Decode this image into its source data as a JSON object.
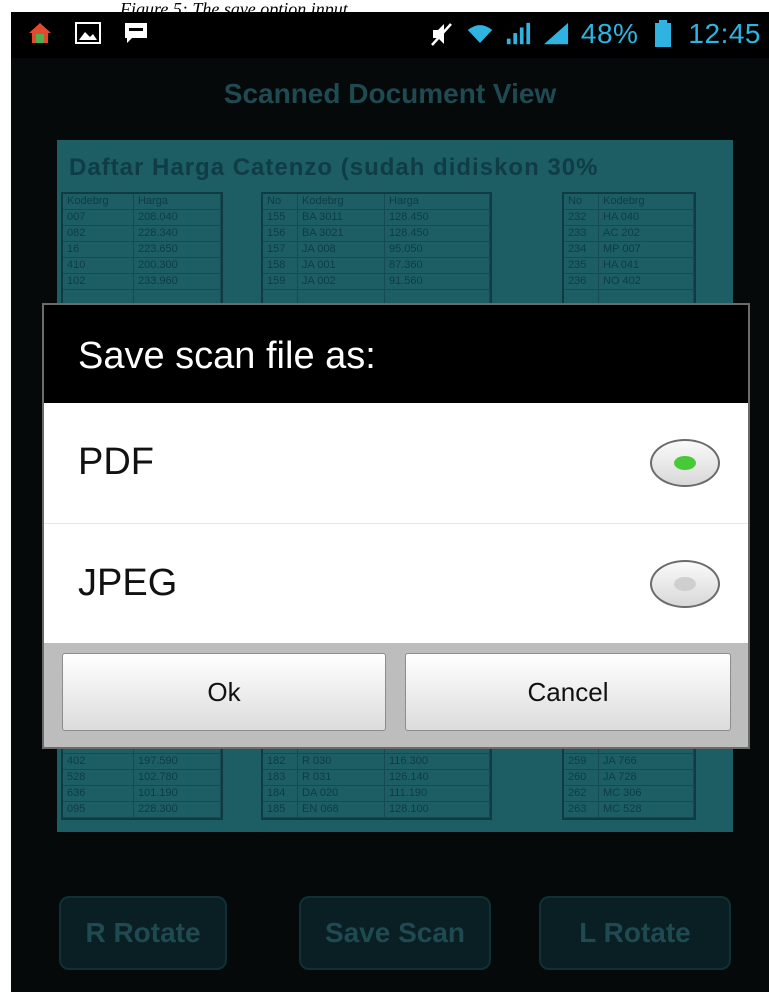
{
  "caption": "Figure 5: The save option input.",
  "status_bar": {
    "battery_percent": "48%",
    "time": "12:45",
    "accent_color": "#2fb4e2",
    "left_icons": [
      "maps-icon",
      "image-icon",
      "chat-icon"
    ],
    "right_icons": [
      "mute-icon",
      "wifi-icon",
      "signal-icon",
      "signal-icon-2",
      "battery-icon"
    ]
  },
  "screen": {
    "title": "Scanned Document View"
  },
  "scan": {
    "heading": "Daftar Harga Catenzo (sudah didiskon 30%",
    "tables": [
      {
        "headers": [
          "Kodebrg",
          "Harga"
        ],
        "rows": [
          [
            "007",
            "208.040"
          ],
          [
            "082",
            "228.340"
          ],
          [
            "16",
            "223.650"
          ],
          [
            "410",
            "200.300"
          ],
          [
            "102",
            "233.960"
          ],
          [
            "",
            ""
          ],
          [
            "",
            ""
          ],
          [
            "",
            ""
          ],
          [
            "",
            ""
          ],
          [
            "",
            ""
          ],
          [
            "",
            ""
          ],
          [
            "",
            ""
          ],
          [
            "",
            ""
          ],
          [
            "",
            ""
          ],
          [
            "",
            ""
          ],
          [
            "",
            ""
          ],
          [
            "",
            ""
          ],
          [
            "",
            ""
          ],
          [
            "",
            ""
          ],
          [
            "",
            ""
          ],
          [
            "",
            ""
          ],
          [
            "",
            ""
          ],
          [
            "",
            ""
          ],
          [
            "",
            ""
          ],
          [
            "",
            ""
          ],
          [
            "",
            ""
          ],
          [
            "",
            ""
          ],
          [
            "",
            ""
          ],
          [
            "",
            ""
          ],
          [
            "",
            ""
          ],
          [
            "",
            ""
          ],
          [
            "",
            ""
          ],
          [
            "",
            ""
          ],
          [
            "",
            ""
          ],
          [
            "402",
            "197.590"
          ],
          [
            "528",
            "102.780"
          ],
          [
            "636",
            "101.190"
          ],
          [
            "095",
            "228.300"
          ]
        ]
      },
      {
        "headers": [
          "No",
          "Kodebrg",
          "Harga"
        ],
        "rows": [
          [
            "155",
            "BA 3011",
            "128.450"
          ],
          [
            "156",
            "BA 3021",
            "128.450"
          ],
          [
            "157",
            "JA 008",
            "95.050"
          ],
          [
            "158",
            "JA 001",
            "87.360"
          ],
          [
            "159",
            "JA 002",
            "91.560"
          ],
          [
            "",
            "",
            ""
          ],
          [
            "",
            "",
            ""
          ],
          [
            "",
            "",
            ""
          ],
          [
            "",
            "",
            ""
          ],
          [
            "",
            "",
            ""
          ],
          [
            "",
            "",
            ""
          ],
          [
            "",
            "",
            ""
          ],
          [
            "",
            "",
            ""
          ],
          [
            "",
            "",
            ""
          ],
          [
            "",
            "",
            ""
          ],
          [
            "",
            "",
            ""
          ],
          [
            "",
            "",
            ""
          ],
          [
            "",
            "",
            ""
          ],
          [
            "",
            "",
            ""
          ],
          [
            "",
            "",
            ""
          ],
          [
            "",
            "",
            ""
          ],
          [
            "",
            "",
            ""
          ],
          [
            "",
            "",
            ""
          ],
          [
            "",
            "",
            ""
          ],
          [
            "",
            "",
            ""
          ],
          [
            "",
            "",
            ""
          ],
          [
            "",
            "",
            ""
          ],
          [
            "",
            "",
            ""
          ],
          [
            "",
            "",
            ""
          ],
          [
            "",
            "",
            ""
          ],
          [
            "",
            "",
            ""
          ],
          [
            "",
            "",
            ""
          ],
          [
            "",
            "",
            ""
          ],
          [
            "",
            "",
            ""
          ],
          [
            "182",
            "R 030",
            "116.300"
          ],
          [
            "183",
            "R 031",
            "126.140"
          ],
          [
            "184",
            "DA 020",
            "111.190"
          ],
          [
            "185",
            "EN 068",
            "128.100"
          ]
        ]
      },
      {
        "headers": [
          "No",
          "Kodebrg"
        ],
        "rows": [
          [
            "232",
            "HA 040"
          ],
          [
            "233",
            "AC 202"
          ],
          [
            "234",
            "MP 007"
          ],
          [
            "235",
            "HA 041"
          ],
          [
            "236",
            "NO 402"
          ],
          [
            "",
            ""
          ],
          [
            "",
            ""
          ],
          [
            "",
            ""
          ],
          [
            "",
            ""
          ],
          [
            "",
            ""
          ],
          [
            "",
            ""
          ],
          [
            "",
            ""
          ],
          [
            "",
            ""
          ],
          [
            "",
            ""
          ],
          [
            "",
            ""
          ],
          [
            "",
            ""
          ],
          [
            "",
            ""
          ],
          [
            "",
            ""
          ],
          [
            "",
            ""
          ],
          [
            "",
            ""
          ],
          [
            "",
            ""
          ],
          [
            "",
            ""
          ],
          [
            "",
            ""
          ],
          [
            "",
            ""
          ],
          [
            "",
            ""
          ],
          [
            "",
            ""
          ],
          [
            "",
            ""
          ],
          [
            "",
            ""
          ],
          [
            "",
            ""
          ],
          [
            "",
            ""
          ],
          [
            "",
            ""
          ],
          [
            "",
            ""
          ],
          [
            "",
            ""
          ],
          [
            "",
            ""
          ],
          [
            "259",
            "JA 766"
          ],
          [
            "260",
            "JA 728"
          ],
          [
            "262",
            "MC 306"
          ],
          [
            "263",
            "MC 528"
          ]
        ]
      }
    ]
  },
  "dialog": {
    "title": "Save scan file as:",
    "options": [
      {
        "label": "PDF",
        "selected": true,
        "dot_color": "#49c83a"
      },
      {
        "label": "JPEG",
        "selected": false,
        "dot_color": "#cfcfcf"
      }
    ],
    "ok_label": "Ok",
    "cancel_label": "Cancel"
  },
  "bottom_buttons": {
    "r_rotate": "R Rotate",
    "save_scan": "Save Scan",
    "l_rotate": "L Rotate"
  }
}
